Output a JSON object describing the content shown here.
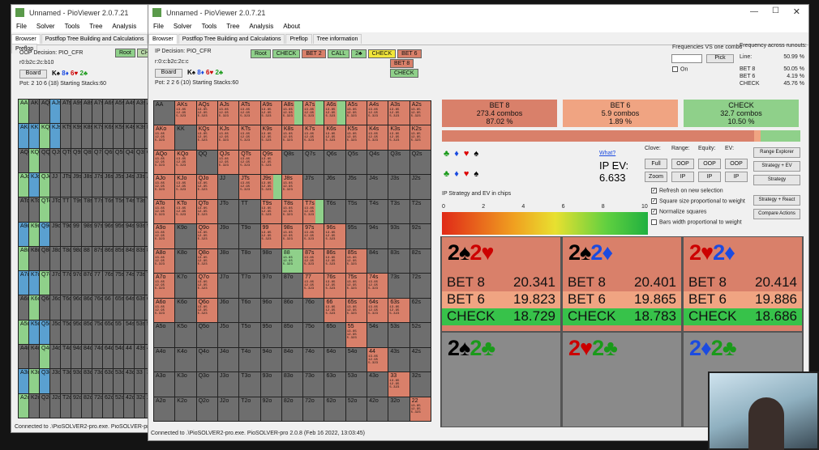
{
  "back_window": {
    "title": "Unnamed - PioViewer 2.0.7.21",
    "menu": [
      "File",
      "Solver",
      "Tools",
      "Tree",
      "Analysis",
      "About"
    ],
    "tabs": [
      "Browser",
      "Postflop Tree Building and Calculations",
      "Preflop"
    ],
    "decision": "OOP Decision:  PIO_CFR",
    "board_code": "r0:b2c:2c:b10",
    "board_button": "Board",
    "pot": "Pot: 2 10 6 (18) Starting Stacks:60",
    "actions": [
      "Root",
      "CH"
    ],
    "status": "Connected to .\\PioSOLVER2-pro.exe. PioSOLVER-pro 2"
  },
  "front_window": {
    "title": "Unnamed - PioViewer 2.0.7.21",
    "menu": [
      "File",
      "Solver",
      "Tools",
      "Tree",
      "Analysis",
      "About"
    ],
    "tabs": [
      "Browser",
      "Postflop Tree Building and Calculations",
      "Preflop",
      "Tree information"
    ],
    "decision": "IP Decision:  PIO_CFR",
    "board_code": "r:0:c:b2c:2c:c",
    "board_button": "Board",
    "pot": "Pot: 2 2 6 (10) Starting Stacks:60",
    "actions_row1": [
      "Root",
      "CHECK",
      "BET 2",
      "CALL",
      "2♣",
      "CHECK",
      "BET 6"
    ],
    "actions_row2": [
      "BET 8"
    ],
    "actions_row3": [
      "CHECK"
    ],
    "freq_vs_combo": "Frequencies VS one combo",
    "pick": "Pick",
    "on_label": "On",
    "freq_runouts_title": "Frequency across runouts:",
    "freq_runouts": [
      {
        "label": "Line:",
        "value": "50.99 %"
      },
      {
        "label": "BET 8",
        "value": "50.05 %"
      },
      {
        "label": "BET 6",
        "value": "4.19 %"
      },
      {
        "label": "CHECK",
        "value": "45.76 %"
      }
    ],
    "status": "Connected to .\\PioSOLVER2-pro.exe. PioSOLVER-pro 2.0.8 (Feb 16 2022, 13:03:45)"
  },
  "strategy_boxes": [
    {
      "name": "BET 8",
      "combos": "273.4 combos",
      "pct": "87.02 %",
      "color": "#d9806a"
    },
    {
      "name": "BET 6",
      "combos": "5.9 combos",
      "pct": "1.89 %",
      "color": "#f0a482"
    },
    {
      "name": "CHECK",
      "combos": "32.7 combos",
      "pct": "10.50 %",
      "color": "#8fd08a"
    }
  ],
  "what_link": "What?",
  "ip_ev_label": "IP EV:",
  "ip_ev_value": "6.633",
  "chart_caption": "IP Strategy and EV in chips",
  "scale_ticks": [
    "0",
    "2",
    "4",
    "6",
    "8",
    "10"
  ],
  "col_headers": [
    "Clove:",
    "Range:",
    "Equity:",
    "EV:"
  ],
  "small_buttons": [
    "Full",
    "OOP",
    "OOP",
    "OOP",
    "Zoom",
    "IP",
    "IP",
    "IP"
  ],
  "right_buttons": [
    "Range Explorer",
    "Strategy + EV",
    "Strategy",
    "Strategy + React",
    "Compare Actions"
  ],
  "checkboxes": [
    {
      "label": "Refresh on new selection",
      "checked": true
    },
    {
      "label": "Square size proportional to weight",
      "checked": true
    },
    {
      "label": "Normalize squares",
      "checked": true
    },
    {
      "label": "Bars width proportional to weight",
      "checked": false
    }
  ],
  "hand_cards": [
    {
      "c1": "2♠",
      "c1cls": "blk",
      "c2": "2♥",
      "c2cls": "red",
      "rows": [
        [
          "BET 8",
          "20.341"
        ],
        [
          "BET 6",
          "19.823"
        ],
        [
          "CHECK",
          "18.729"
        ]
      ]
    },
    {
      "c1": "2♠",
      "c1cls": "blk",
      "c2": "2♦",
      "c2cls": "blu",
      "rows": [
        [
          "BET 8",
          "20.401"
        ],
        [
          "BET 6",
          "19.865"
        ],
        [
          "CHECK",
          "18.783"
        ]
      ]
    },
    {
      "c1": "2♥",
      "c1cls": "red",
      "c2": "2♦",
      "c2cls": "blu",
      "rows": [
        [
          "BET 8",
          "20.414"
        ],
        [
          "BET 6",
          "19.886"
        ],
        [
          "CHECK",
          "18.686"
        ]
      ]
    },
    {
      "c1": "2♠",
      "c1cls": "blk",
      "c2": "2♣",
      "c2cls": "grn",
      "rows": []
    },
    {
      "c1": "2♥",
      "c1cls": "red",
      "c2": "2♣",
      "c2cls": "grn",
      "rows": []
    },
    {
      "c1": "2♦",
      "c1cls": "blu",
      "c2": "2♣",
      "c2cls": "grn",
      "rows": []
    }
  ],
  "row_colors": {
    "BET 8": "#d9806a",
    "BET 6": "#f0a482",
    "CHECK": "#37c24a"
  },
  "ranks": [
    "A",
    "K",
    "Q",
    "J",
    "T",
    "9",
    "8",
    "7",
    "6",
    "5",
    "4",
    "3",
    "2"
  ],
  "suit_icons_top": [
    "♣",
    "♦",
    "♥",
    "♠"
  ],
  "suit_icons_bot": [
    "♣",
    "♦",
    "♥",
    "♠"
  ]
}
